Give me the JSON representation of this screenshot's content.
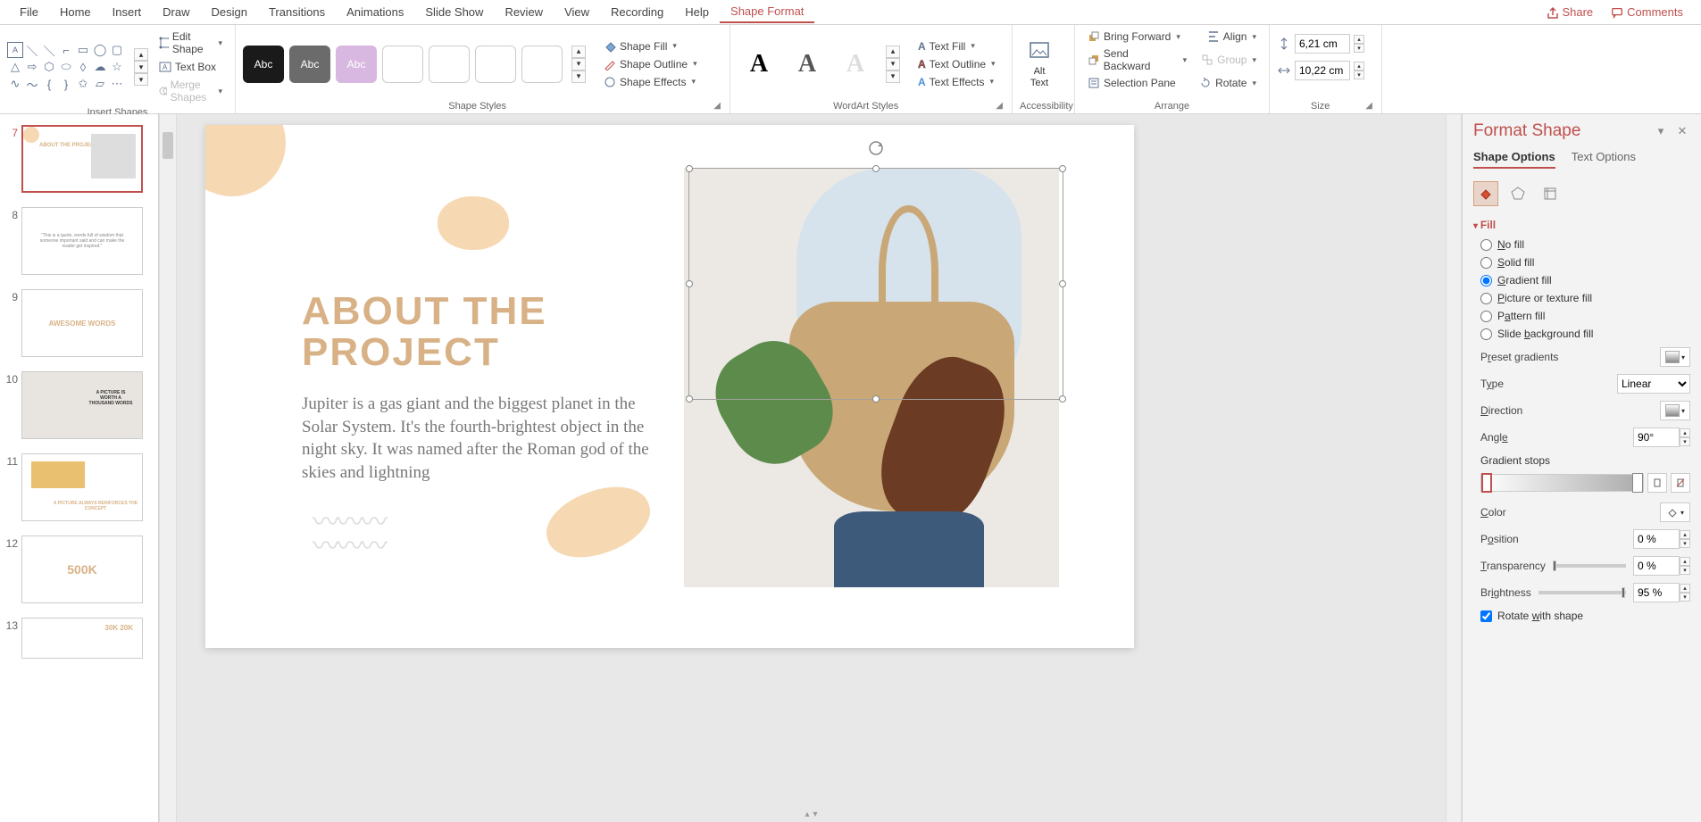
{
  "menu": {
    "items": [
      "File",
      "Home",
      "Insert",
      "Draw",
      "Design",
      "Transitions",
      "Animations",
      "Slide Show",
      "Review",
      "View",
      "Recording",
      "Help",
      "Shape Format"
    ],
    "active": "Shape Format",
    "share": "Share",
    "comments": "Comments"
  },
  "ribbon": {
    "insert_shapes": {
      "edit_shape": "Edit Shape",
      "text_box": "Text Box",
      "merge_shapes": "Merge Shapes",
      "label": "Insert Shapes"
    },
    "shape_styles": {
      "label": "Shape Styles",
      "fill": "Shape Fill",
      "outline": "Shape Outline",
      "effects": "Shape Effects",
      "sample": "Abc"
    },
    "wordart": {
      "label": "WordArt Styles",
      "text_fill": "Text Fill",
      "text_outline": "Text Outline",
      "text_effects": "Text Effects",
      "sample": "A"
    },
    "accessibility": {
      "label": "Accessibility",
      "alt_text": "Alt Text"
    },
    "arrange": {
      "label": "Arrange",
      "bring_forward": "Bring Forward",
      "send_backward": "Send Backward",
      "selection_pane": "Selection Pane",
      "align": "Align",
      "group": "Group",
      "rotate": "Rotate"
    },
    "size": {
      "label": "Size",
      "height": "6,21 cm",
      "width": "10,22 cm"
    }
  },
  "thumbs": [
    {
      "num": "7",
      "active": true,
      "title": "ABOUT THE PROJECT"
    },
    {
      "num": "8",
      "active": false,
      "title": "\"This is a quote, words full of wisdom that someone important said and can make the reader get inspired.\""
    },
    {
      "num": "9",
      "active": false,
      "title": "AWESOME WORDS"
    },
    {
      "num": "10",
      "active": false,
      "title": "A PICTURE IS WORTH A THOUSAND WORDS"
    },
    {
      "num": "11",
      "active": false,
      "title": "A PICTURE ALWAYS REINFORCES THE CONCEPT"
    },
    {
      "num": "12",
      "active": false,
      "title": "500K"
    },
    {
      "num": "13",
      "active": false,
      "title": "30K 20K"
    }
  ],
  "slide": {
    "title_line1": "ABOUT THE",
    "title_line2": "PROJECT",
    "body": "Jupiter is a gas giant and the biggest planet in the Solar System. It's the fourth-brightest object in the night sky. It was named after the Roman god of the skies and lightning"
  },
  "format_pane": {
    "title": "Format Shape",
    "tabs": {
      "shape_options": "Shape Options",
      "text_options": "Text Options"
    },
    "section_fill": "Fill",
    "fills": {
      "no_fill": "No fill",
      "solid": "Solid fill",
      "gradient": "Gradient fill",
      "picture": "Picture or texture fill",
      "pattern": "Pattern fill",
      "slide_bg": "Slide background fill"
    },
    "selected_fill": "gradient",
    "preset": "Preset gradients",
    "type_label": "Type",
    "type_value": "Linear",
    "direction": "Direction",
    "angle_label": "Angle",
    "angle_value": "90°",
    "grad_stops": "Gradient stops",
    "color": "Color",
    "position_label": "Position",
    "position_value": "0 %",
    "transparency_label": "Transparency",
    "transparency_value": "0 %",
    "brightness_label": "Brightness",
    "brightness_value": "95 %",
    "rotate_with_shape": "Rotate with shape"
  }
}
